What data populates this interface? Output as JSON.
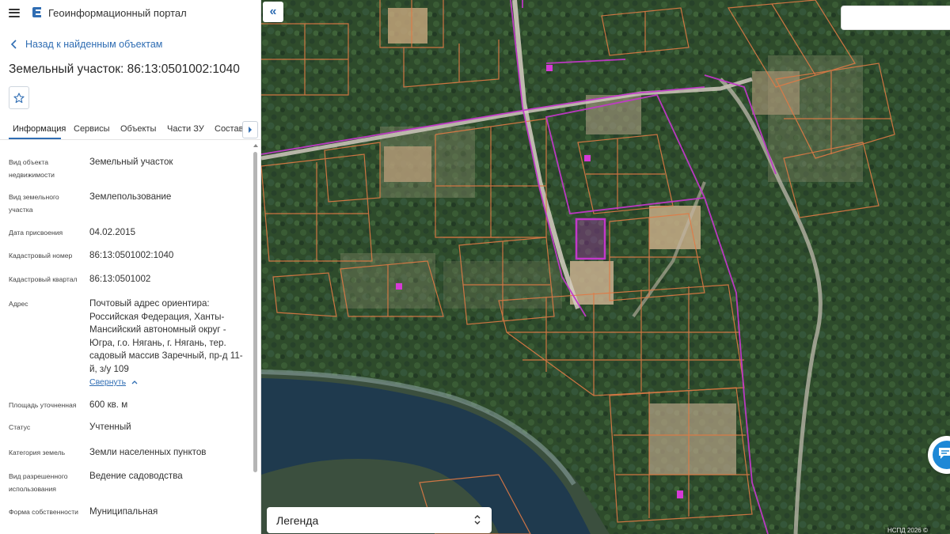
{
  "app": {
    "title": "Геоинформационный портал"
  },
  "nav": {
    "back_label": "Назад к найденным объектам"
  },
  "object": {
    "title": "Земельный участок: 86:13:0501002:1040"
  },
  "tabs": [
    {
      "label": "Информация"
    },
    {
      "label": "Сервисы"
    },
    {
      "label": "Объекты"
    },
    {
      "label": "Части ЗУ"
    },
    {
      "label": "Состав"
    }
  ],
  "properties": [
    {
      "label": "Вид объекта недвижимости",
      "value": "Земельный участок"
    },
    {
      "label": "Вид земельного участка",
      "value": "Землепользование"
    },
    {
      "label": "Дата присвоения",
      "value": "04.02.2015"
    },
    {
      "label": "Кадастровый номер",
      "value": "86:13:0501002:1040"
    },
    {
      "label": "Кадастровый квартал",
      "value": "86:13:0501002"
    },
    {
      "label": "Адрес",
      "value": "Почтовый адрес ориентира: Российская Федерация, Ханты-Мансийский автономный округ - Югра, г.о. Нягань, г. Нягань, тер. садовый массив Заречный, пр-д 11-й, з/у 109"
    },
    {
      "label": "Площадь уточненная",
      "value": "600 кв. м"
    },
    {
      "label": "Статус",
      "value": "Учтенный"
    },
    {
      "label": "Категория земель",
      "value": "Земли населенных пунктов"
    },
    {
      "label": "Вид разрешенного использования",
      "value": "Ведение садоводства"
    },
    {
      "label": "Форма собственности",
      "value": "Муниципальная"
    }
  ],
  "address_toggle": {
    "label": "Свернуть"
  },
  "legend": {
    "label": "Легенда"
  },
  "map": {
    "attribution": "НСПД 2026 ©"
  },
  "colors": {
    "accent": "#2f6db3",
    "parcel_line": "#e07a45",
    "quarter_line": "#c238c9"
  }
}
